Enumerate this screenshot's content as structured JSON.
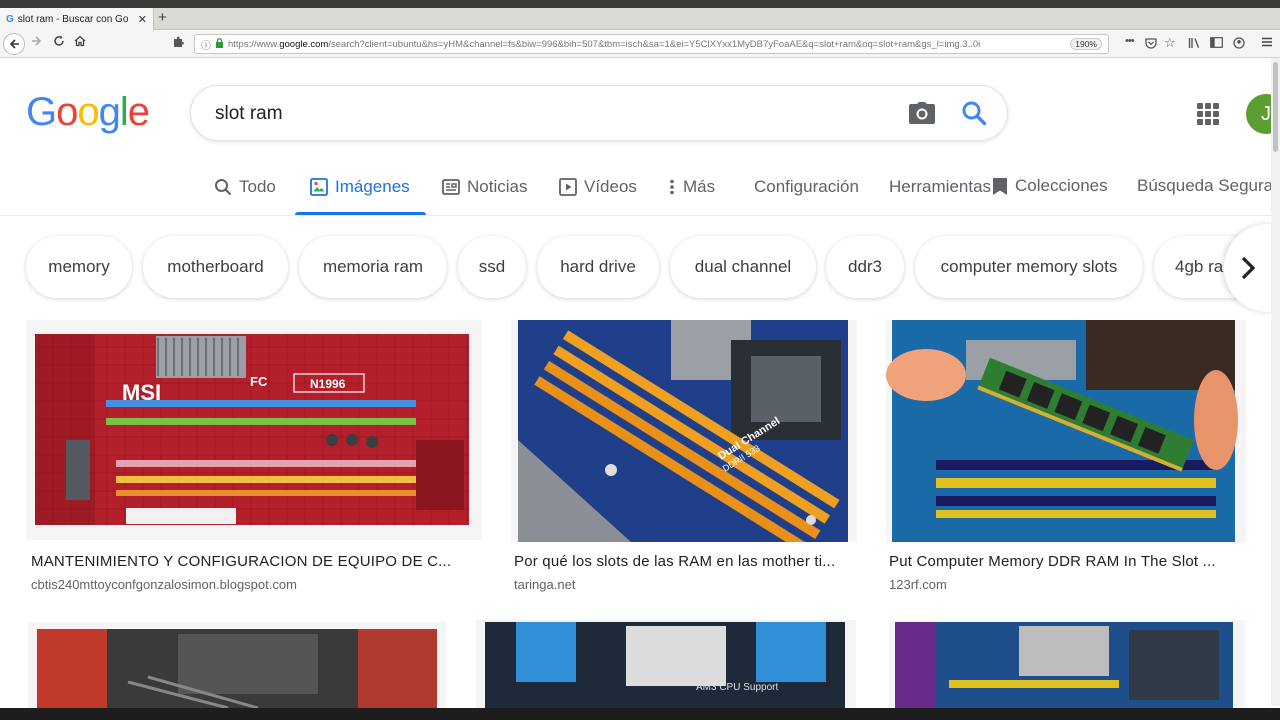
{
  "browser": {
    "tab_title": "slot ram - Buscar con Go",
    "tab_favicon": "G",
    "tab_close": "✕",
    "new_tab": "+",
    "url_prefix": "https://www.",
    "url_host": "google.com",
    "url_rest": "/search?client=ubuntu&hs=yHM&channel=fs&biw=996&bih=507&tbm=isch&sa=1&ei=Y5ClXYxx1MyDB7yFoaAE&q=slot+ram&oq=slot+ram&gs_l=img.3..0i",
    "zoom": "190%",
    "menu_dots": "•••"
  },
  "google": {
    "logo_letters": [
      "G",
      "o",
      "o",
      "g",
      "l",
      "e"
    ],
    "logo_colors": [
      "#4285F4",
      "#EA4335",
      "#FBBC05",
      "#4285F4",
      "#34A853",
      "#EA4335"
    ],
    "query": "slot ram",
    "avatar_initial": "J"
  },
  "tabs": {
    "todo": "Todo",
    "imagenes": "Imágenes",
    "noticias": "Noticias",
    "videos": "Vídeos",
    "mas": "Más",
    "configuracion": "Configuración",
    "herramientas": "Herramientas",
    "colecciones": "Colecciones",
    "busqueda_segura": "Búsqueda Segura"
  },
  "chips": [
    "memory",
    "motherboard",
    "memoria ram",
    "ssd",
    "hard drive",
    "dual channel",
    "ddr3",
    "computer memory slots",
    "4gb ra"
  ],
  "results": [
    {
      "title": "MANTENIMIENTO Y CONFIGURACION DE EQUIPO DE C...",
      "source": "cbtis240mttoyconfgonzalosimon.blogspot.com"
    },
    {
      "title": "Por qué los slots de las RAM en las mother ti...",
      "source": "taringa.net"
    },
    {
      "title": "Put Computer Memory DDR RAM In The Slot ...",
      "source": "123rf.com"
    }
  ],
  "thumb_text": {
    "msi_brand": "MSI",
    "msi_model": "N1996",
    "msi_fc": "FC",
    "dual_channel": "Dual Channel",
    "ddr": "DDRII 533",
    "cpu_support": "AM3 CPU Support"
  },
  "colors": {
    "accent": "#1a73e8",
    "text": "#202124",
    "muted": "#5f6368"
  }
}
